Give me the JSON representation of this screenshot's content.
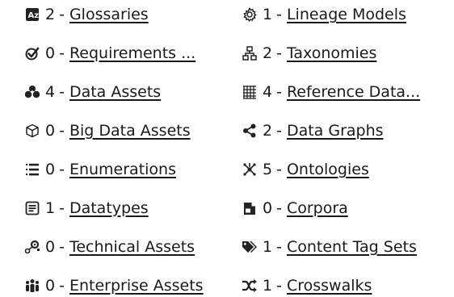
{
  "left_column": [
    {
      "icon": "glossary-icon",
      "count": "2",
      "separator": "-",
      "label": "Glossaries"
    },
    {
      "icon": "check-badge-icon",
      "count": "0",
      "separator": "-",
      "label": "Requirements ..."
    },
    {
      "icon": "data-assets-icon",
      "count": "4",
      "separator": "-",
      "label": "Data Assets"
    },
    {
      "icon": "cube-icon",
      "count": "0",
      "separator": "-",
      "label": "Big Data Assets"
    },
    {
      "icon": "list-icon",
      "count": "0",
      "separator": "-",
      "label": "Enumerations"
    },
    {
      "icon": "datatype-icon",
      "count": "1",
      "separator": "-",
      "label": "Datatypes"
    },
    {
      "icon": "nodes-icon",
      "count": "0",
      "separator": "-",
      "label": "Technical Assets"
    },
    {
      "icon": "enterprise-people-icon",
      "count": "0",
      "separator": "-",
      "label": "Enterprise Assets"
    }
  ],
  "right_column": [
    {
      "icon": "gear-icon",
      "count": "1",
      "separator": "-",
      "label": "Lineage Models"
    },
    {
      "icon": "taxonomy-icon",
      "count": "2",
      "separator": "-",
      "label": "Taxonomies"
    },
    {
      "icon": "grid-icon",
      "count": "4",
      "separator": "-",
      "label": "Reference Data..."
    },
    {
      "icon": "share-icon",
      "count": "2",
      "separator": "-",
      "label": "Data Graphs"
    },
    {
      "icon": "ontology-icon",
      "count": "5",
      "separator": "-",
      "label": "Ontologies"
    },
    {
      "icon": "document-icon",
      "count": "0",
      "separator": "-",
      "label": "Corpora"
    },
    {
      "icon": "tags-icon",
      "count": "1",
      "separator": "-",
      "label": "Content Tag Sets"
    },
    {
      "icon": "shuffle-icon",
      "count": "1",
      "separator": "-",
      "label": "Crosswalks"
    }
  ]
}
